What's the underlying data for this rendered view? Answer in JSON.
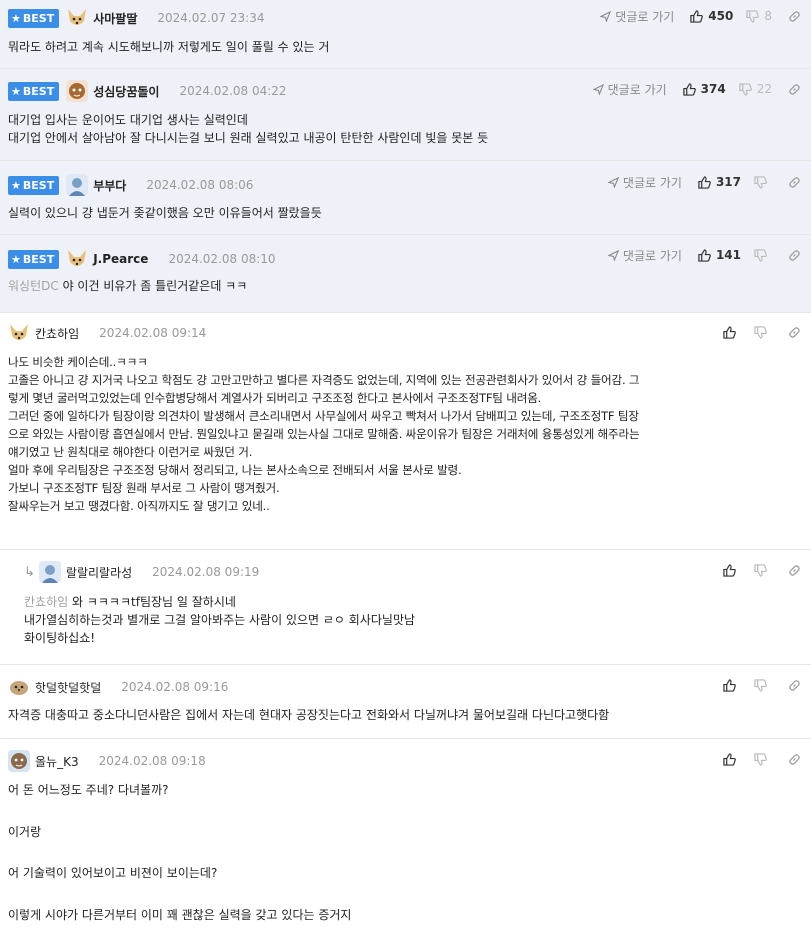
{
  "labels": {
    "best": "BEST",
    "reply": "댓글로 가기"
  },
  "colors": {
    "accent": "#3b8ee8",
    "best_bg": "#eef2f8"
  },
  "comments": [
    {
      "nick": "사마팔딸",
      "date": "2024.02.07 23:34",
      "up": "450",
      "down": "8",
      "body": [
        "뭐라도 하려고 계속 시도해보니까 저렇게도 일이 풀릴 수 있는 거"
      ]
    },
    {
      "nick": "성심당꿈돌이",
      "date": "2024.02.08 04:22",
      "up": "374",
      "down": "22",
      "body": [
        "대기업 입사는 운이어도 대기업 생사는 실력인데",
        "대기업 안에서 살아남아 잘 다니시는걸 보니 원래 실력있고 내공이 탄탄한 사람인데 빛을 못본 듯"
      ]
    },
    {
      "nick": "부부다",
      "date": "2024.02.08 08:06",
      "up": "317",
      "down": "",
      "body": [
        "실력이 있으니 걍 냅둔거 좆같이했음 오만 이유들어서 짤랐을듯"
      ]
    },
    {
      "nick": "J.Pearce",
      "date": "2024.02.08 08:10",
      "up": "141",
      "down": "",
      "ref": "워싱턴DC",
      "body": [
        "야 이건 비유가 좀 틀린거같은데 ㅋㅋ"
      ]
    },
    {
      "nick": "칸쵸하임",
      "date": "2024.02.08 09:14",
      "body": [
        "나도 비슷한 케이슨데..ㅋㅋㅋ",
        "고졸은 아니고 걍 지거국 나오고 학점도 걍 고만고만하고 별다른 자격증도 없었는데, 지역에 있는 전공관련회사가 있어서 걍 들어감. 그",
        "렇게 몇년 굴러먹고있었는데 인수합병당해서 계열사가 되버리고 구조조정 한다고 본사에서 구조조정TF팀 내려옴.",
        "그러던 중에 일하다가 팀장이랑 의견차이 발생해서 큰소리내면서 사무실에서 싸우고 빡쳐서 나가서 담배피고 있는데, 구조조정TF 팀장",
        "으로 와있는 사람이랑 흡연실에서 만남. 뭔일있냐고 묻길래 있는사실 그대로 말해줌. 싸운이유가 팀장은 거래처에 융통성있게 해주라는",
        "얘기였고 난 원칙대로 해야한다 이런거로 싸웠던 거.",
        "얼마 후에 우리팀장은 구조조정 당해서 정리되고, 나는 본사소속으로 전배되서 서울 본사로 발령.",
        "가보니 구조조정TF 팀장 원래 부서로 그 사람이 땡겨줬거.",
        "잘싸우는거 보고 땡겼다함. 아직까지도 잘 댕기고 있네.."
      ]
    },
    {
      "nick": "랄랄리랄라성",
      "date": "2024.02.08 09:19",
      "ref": "칸쵸하임",
      "body": [
        "와 ㅋㅋㅋㅋtf팀장님 일 잘하시네",
        "내가열심히하는것과 별개로 그걸 알아봐주는 사람이 있으면 ㄹㅇ 회사다닐맛남",
        "화이팅하십쇼!"
      ]
    },
    {
      "nick": "핫덜핫덜핫덜",
      "date": "2024.02.08 09:16",
      "body": [
        "자격증 대충따고 중소다니던사람은 집에서 자는데 현대자 공장짓는다고 전화와서 다닐꺼냐겨 물어보길래 다닌다고햇다함"
      ]
    },
    {
      "nick": "올뉴_K3",
      "date": "2024.02.08 09:18",
      "body": [
        "어 돈 어느정도 주네? 다녀볼까?",
        "",
        "이거랑",
        "",
        "어 기술력이 있어보이고 비젼이 보이는데?",
        "",
        "이렇게 시야가 다른거부터 이미 꽤 괜찮은 실력을 갖고 있다는 증거지"
      ]
    }
  ]
}
